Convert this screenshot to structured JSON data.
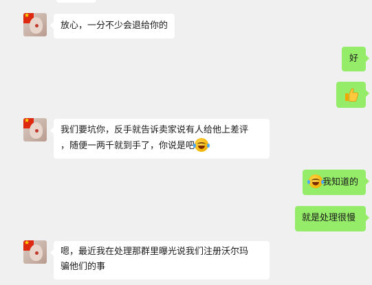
{
  "messages": [
    {
      "side": "left",
      "text": "放心，一分不少会退给你的"
    },
    {
      "side": "right",
      "text": "好"
    },
    {
      "side": "right",
      "icon": "thumbs-up-icon"
    },
    {
      "side": "left",
      "text_line1": "我们要坑你，反手就告诉卖家说有人给他上差评",
      "text_line2": "，随便一两千就到手了，你说是吧",
      "icon": "laugh-cry-emoji-icon"
    },
    {
      "side": "right",
      "icon": "laugh-cry-emoji-icon",
      "text": "我知道的"
    },
    {
      "side": "right",
      "text": "就是处理很慢"
    },
    {
      "side": "left",
      "text_line1": "嗯，最近我在处理那群里曝光说我们注册沃尔玛",
      "text_line2": "骗他们的事"
    }
  ],
  "colors": {
    "background": "#f0f0f0",
    "incoming_bubble": "#ffffff",
    "outgoing_bubble": "#95ec69",
    "avatar_flag": "#de2910"
  }
}
